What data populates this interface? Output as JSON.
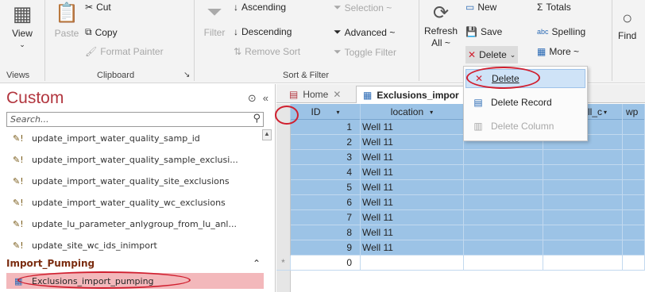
{
  "ribbon": {
    "views": {
      "view_label": "View",
      "group_label": "Views"
    },
    "clipboard": {
      "paste_label": "Paste",
      "cut_label": "Cut",
      "copy_label": "Copy",
      "format_painter_label": "Format Painter",
      "group_label": "Clipboard"
    },
    "sort_filter": {
      "filter_label": "Filter",
      "ascending_label": "Ascending",
      "descending_label": "Descending",
      "remove_sort_label": "Remove Sort",
      "selection_label": "Selection ~",
      "advanced_label": "Advanced ~",
      "toggle_filter_label": "Toggle Filter",
      "group_label": "Sort & Filter"
    },
    "records": {
      "refresh_label": "Refresh",
      "refresh_all_label": "All ~",
      "new_label": "New",
      "save_label": "Save",
      "delete_label": "Delete",
      "totals_label": "Totals",
      "spelling_label": "Spelling",
      "more_label": "More ~"
    },
    "find": {
      "find_label": "Find"
    }
  },
  "nav": {
    "title": "Custom",
    "search_placeholder": "Search...",
    "items": [
      "update_import_water_quality_samp_id",
      "update_import_water_quality_sample_exclusi...",
      "update_import_water_quality_site_exclusions",
      "update_import_water_quality_wc_exclusions",
      "update_lu_parameter_anlygroup_from_lu_anl...",
      "update_site_wc_ids_inimport"
    ],
    "group_header": "Import_Pumping",
    "selected_item": "Exclusions_import_pumping"
  },
  "tabs": {
    "home": "Home",
    "active": "Exclusions_impor"
  },
  "sheet": {
    "headers": [
      "ID",
      "location",
      "tall_c",
      "wp"
    ],
    "rows": [
      {
        "id": "1",
        "location": "Well 11"
      },
      {
        "id": "2",
        "location": "Well 11"
      },
      {
        "id": "3",
        "location": "Well 11"
      },
      {
        "id": "4",
        "location": "Well 11"
      },
      {
        "id": "5",
        "location": "Well 11"
      },
      {
        "id": "6",
        "location": "Well 11"
      },
      {
        "id": "7",
        "location": "Well 11"
      },
      {
        "id": "8",
        "location": "Well 11"
      },
      {
        "id": "9",
        "location": "Well 11"
      }
    ],
    "new_row_id": "0",
    "new_row_marker": "*"
  },
  "context_menu": {
    "delete": "Delete",
    "delete_record": "Delete Record",
    "delete_column": "Delete Column"
  },
  "colors": {
    "selection": "#9cc3e6",
    "nav_title": "#b2363f",
    "selected_nav": "#f3b8bb",
    "annotation": "#d01f2f"
  }
}
